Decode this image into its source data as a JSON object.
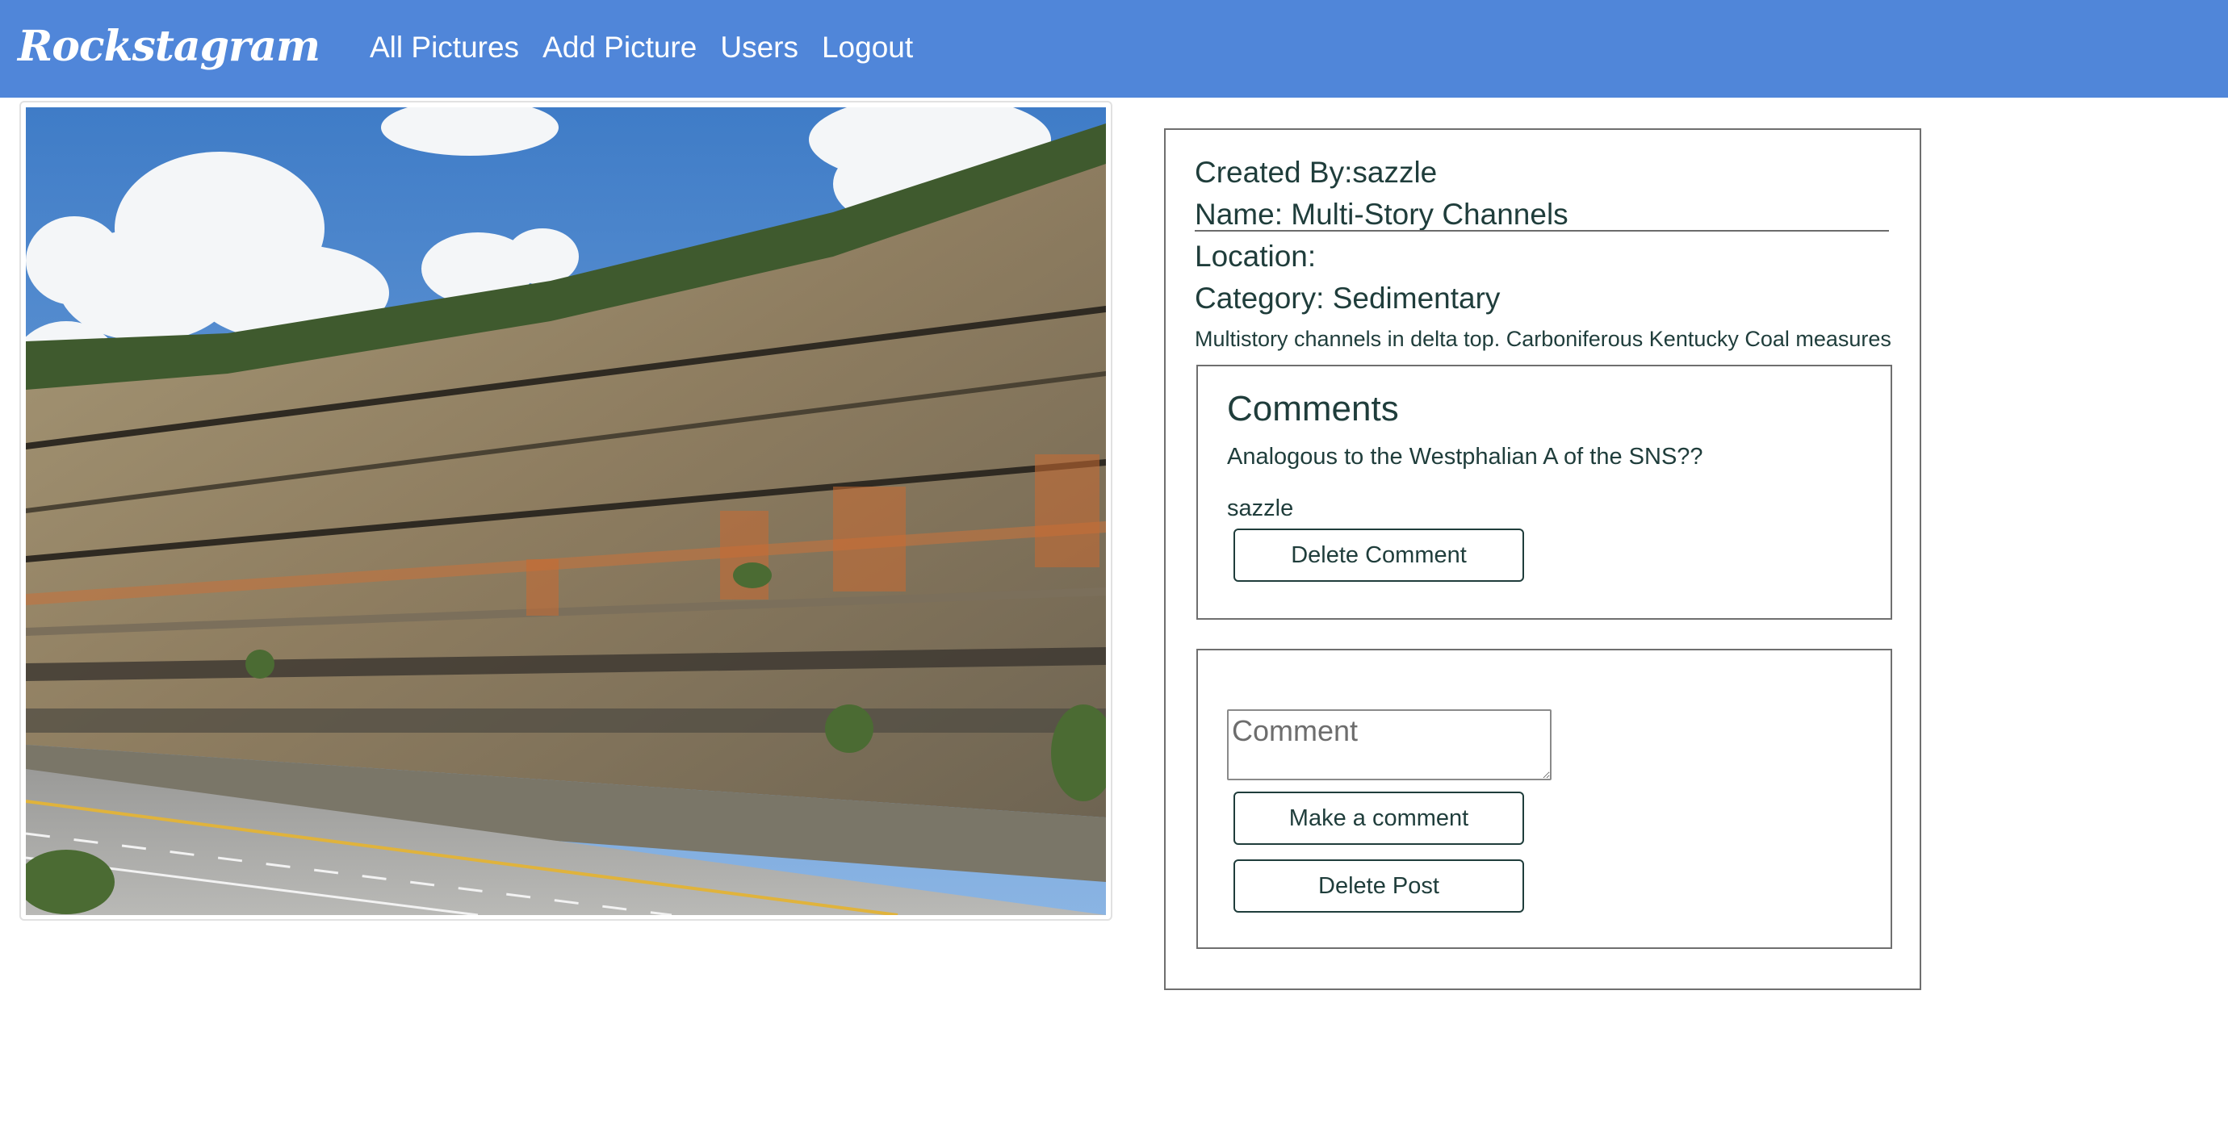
{
  "navbar": {
    "brand": "Rockstagram",
    "links": [
      "All Pictures",
      "Add Picture",
      "Users",
      "Logout"
    ]
  },
  "post": {
    "created_by": "Created By:sazzle",
    "name": "Name: Multi-Story Channels",
    "location": "Location:",
    "category": "Category: Sedimentary",
    "description": "Multistory channels in delta top. Carboniferous Kentucky Coal measures"
  },
  "comments": {
    "heading": "Comments",
    "items": [
      {
        "text": "Analogous to the Westphalian A of the SNS??",
        "author": "sazzle",
        "delete_label": "Delete Comment"
      }
    ]
  },
  "new_comment": {
    "placeholder": "Comment",
    "submit_label": "Make a comment",
    "delete_post_label": "Delete Post"
  },
  "colors": {
    "navbar": "#5086d9",
    "text": "#1f3d3b",
    "border": "#6f6f6f"
  }
}
